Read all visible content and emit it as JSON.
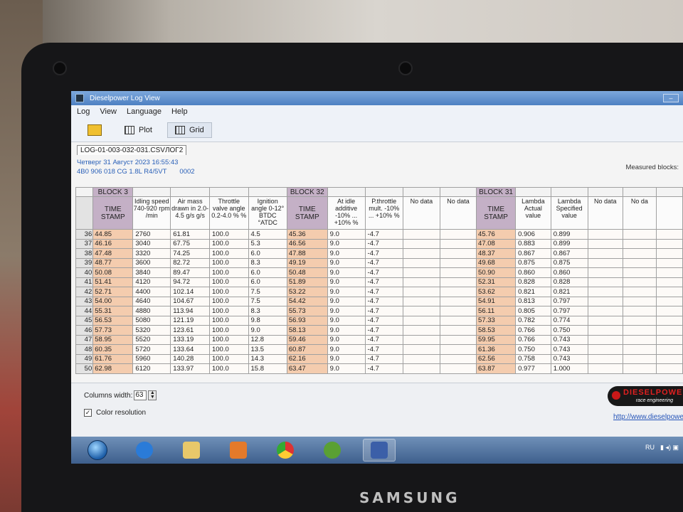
{
  "window": {
    "title": "Dieselpower Log View"
  },
  "menu": [
    "Log",
    "View",
    "Language",
    "Help"
  ],
  "toolbar": {
    "plot": "Plot",
    "grid": "Grid"
  },
  "file_tab": "LOG-01-003-032-031.CSVЛОГ2",
  "info": {
    "date": "Четверг 31 Август 2023 16:55:43",
    "engine": "4B0 906 018 CG  1.8L R4/5VT",
    "code": "0002"
  },
  "measured_label": "Measured blocks:",
  "blocks": [
    "BLOCK 3",
    "BLOCK 32",
    "BLOCK 31"
  ],
  "headers": {
    "ts": "TIME STAMP",
    "idle": "Idling speed 740-920 rpm /min",
    "air": "Air mass drawn in 2.0-4.5 g/s g/s",
    "throttle": "Throttle valve angle 0.2-4.0 % %",
    "ign": "Ignition angle 0-12° BTDC °ATDC",
    "idle_add": "At idle additive -10% ... +10% %",
    "p_mult": "P.throttle mult. -10% ... +10% %",
    "nodata": "No data",
    "lambda_act": "Lambda Actual value",
    "lambda_spec": "Lambda Specified value",
    "nodata_short": "No da"
  },
  "rows": [
    {
      "n": "36",
      "t1": "44.85",
      "idle": "2760",
      "air": "61.81",
      "thr": "100.0",
      "ign": "4.5",
      "t2": "45.36",
      "add": "9.0",
      "mult": "-4.7",
      "t3": "45.76",
      "la": "0.906",
      "ls": "0.899"
    },
    {
      "n": "37",
      "t1": "46.16",
      "idle": "3040",
      "air": "67.75",
      "thr": "100.0",
      "ign": "5.3",
      "t2": "46.56",
      "add": "9.0",
      "mult": "-4.7",
      "t3": "47.08",
      "la": "0.883",
      "ls": "0.899"
    },
    {
      "n": "38",
      "t1": "47.48",
      "idle": "3320",
      "air": "74.25",
      "thr": "100.0",
      "ign": "6.0",
      "t2": "47.88",
      "add": "9.0",
      "mult": "-4.7",
      "t3": "48.37",
      "la": "0.867",
      "ls": "0.867"
    },
    {
      "n": "39",
      "t1": "48.77",
      "idle": "3600",
      "air": "82.72",
      "thr": "100.0",
      "ign": "8.3",
      "t2": "49.19",
      "add": "9.0",
      "mult": "-4.7",
      "t3": "49.68",
      "la": "0.875",
      "ls": "0.875"
    },
    {
      "n": "40",
      "t1": "50.08",
      "idle": "3840",
      "air": "89.47",
      "thr": "100.0",
      "ign": "6.0",
      "t2": "50.48",
      "add": "9.0",
      "mult": "-4.7",
      "t3": "50.90",
      "la": "0.860",
      "ls": "0.860"
    },
    {
      "n": "41",
      "t1": "51.41",
      "idle": "4120",
      "air": "94.72",
      "thr": "100.0",
      "ign": "6.0",
      "t2": "51.89",
      "add": "9.0",
      "mult": "-4.7",
      "t3": "52.31",
      "la": "0.828",
      "ls": "0.828"
    },
    {
      "n": "42",
      "t1": "52.71",
      "idle": "4400",
      "air": "102.14",
      "thr": "100.0",
      "ign": "7.5",
      "t2": "53.22",
      "add": "9.0",
      "mult": "-4.7",
      "t3": "53.62",
      "la": "0.821",
      "ls": "0.821"
    },
    {
      "n": "43",
      "t1": "54.00",
      "idle": "4640",
      "air": "104.67",
      "thr": "100.0",
      "ign": "7.5",
      "t2": "54.42",
      "add": "9.0",
      "mult": "-4.7",
      "t3": "54.91",
      "la": "0.813",
      "ls": "0.797"
    },
    {
      "n": "44",
      "t1": "55.31",
      "idle": "4880",
      "air": "113.94",
      "thr": "100.0",
      "ign": "8.3",
      "t2": "55.73",
      "add": "9.0",
      "mult": "-4.7",
      "t3": "56.11",
      "la": "0.805",
      "ls": "0.797"
    },
    {
      "n": "45",
      "t1": "56.53",
      "idle": "5080",
      "air": "121.19",
      "thr": "100.0",
      "ign": "9.8",
      "t2": "56.93",
      "add": "9.0",
      "mult": "-4.7",
      "t3": "57.33",
      "la": "0.782",
      "ls": "0.774"
    },
    {
      "n": "46",
      "t1": "57.73",
      "idle": "5320",
      "air": "123.61",
      "thr": "100.0",
      "ign": "9.0",
      "t2": "58.13",
      "add": "9.0",
      "mult": "-4.7",
      "t3": "58.53",
      "la": "0.766",
      "ls": "0.750"
    },
    {
      "n": "47",
      "t1": "58.95",
      "idle": "5520",
      "air": "133.19",
      "thr": "100.0",
      "ign": "12.8",
      "t2": "59.46",
      "add": "9.0",
      "mult": "-4.7",
      "t3": "59.95",
      "la": "0.766",
      "ls": "0.743"
    },
    {
      "n": "48",
      "t1": "60.35",
      "idle": "5720",
      "air": "133.64",
      "thr": "100.0",
      "ign": "13.5",
      "t2": "60.87",
      "add": "9.0",
      "mult": "-4.7",
      "t3": "61.36",
      "la": "0.750",
      "ls": "0.743"
    },
    {
      "n": "49",
      "t1": "61.76",
      "idle": "5960",
      "air": "140.28",
      "thr": "100.0",
      "ign": "14.3",
      "t2": "62.16",
      "add": "9.0",
      "mult": "-4.7",
      "t3": "62.56",
      "la": "0.758",
      "ls": "0.743"
    },
    {
      "n": "50",
      "t1": "62.98",
      "idle": "6120",
      "air": "133.97",
      "thr": "100.0",
      "ign": "15.8",
      "t2": "63.47",
      "add": "9.0",
      "mult": "-4.7",
      "t3": "63.87",
      "la": "0.977",
      "ls": "1.000"
    }
  ],
  "bottom": {
    "columns_width_label": "Columns width:",
    "columns_width_value": "63",
    "color_resolution_label": "Color resolution",
    "color_resolution_checked": true,
    "logo_text": "DIESELPOWER",
    "logo_sub": "race engineering",
    "link": "http://www.dieselpower"
  },
  "taskbar": {
    "apps": [
      "start-orb",
      "ie-icon",
      "folder-icon",
      "media-player-icon",
      "chrome-icon",
      "utorrent-icon",
      "dieselpower-icon"
    ],
    "tray_lang": "RU"
  },
  "brand": "SAMSUNG"
}
